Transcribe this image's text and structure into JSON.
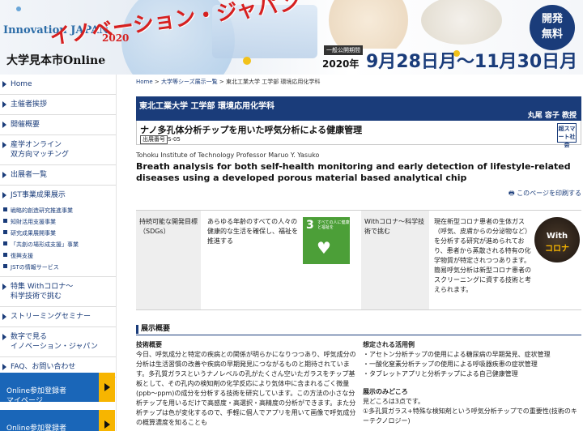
{
  "banner": {
    "logo_sub": "Innovation",
    "logo_main": "イノベーション・ジャパン",
    "logo_japan": "JAPAN",
    "logo_year": "2020",
    "logo_online": "大学見本市Online",
    "free_badge": [
      "開発",
      "無料"
    ],
    "period_label": "一般公開期間",
    "period_year": "2020年",
    "period_dates": "9月28日月〜11月30日月"
  },
  "sidebar": {
    "items": [
      {
        "label": "Home"
      },
      {
        "label": "主催者挨拶"
      },
      {
        "label": "開催概要"
      },
      {
        "label": "産学オンライン\n双方向マッチング"
      },
      {
        "label": "出展者一覧"
      }
    ],
    "jst_group": {
      "label": "JST事業成果展示",
      "subs": [
        "戦略的創造研究推進事業",
        "知財活用支援事業",
        "研究成果展開事業",
        "「共創の場形成支援」事業",
        "復興支援",
        "JSTの情報サービス"
      ]
    },
    "items2": [
      {
        "label": "特集 Withコロナ〜\n科学技術で挑む"
      },
      {
        "label": "ストリーミングセミナー"
      },
      {
        "label": "数字で見る\nイノベーション・ジャパン"
      },
      {
        "label": "FAQ、お問い合わせ"
      }
    ],
    "online_register": "Online参加登録者\nマイページ",
    "online_logout": "Online参加登録者\nログアウト"
  },
  "breadcrumb": {
    "home": "Home",
    "sep": " > ",
    "level1": "大学等シーズ展示一覧",
    "current": "東北工業大学 工学部 環境応用化学科"
  },
  "exhibit": {
    "university": "東北工業大学 工学部 環境応用化学科",
    "professor": "丸尾 容子 教授",
    "title": "ナノ多孔体分析チップを用いた呼気分析による健康管理",
    "label": "出展番号",
    "number": "S-05",
    "tag": "超スマート社会",
    "en_affiliation": "Tohoku Institute of Technology Professor Maruo Y. Yasuko",
    "en_title": "Breath analysis for both self-health monitoring and early detection of lifestyle-related diseases using a developed porous material based analytical chip",
    "print": "このページを印刷する"
  },
  "info": {
    "sdgs_head": "持続可能な開発目標（SDGs）",
    "sdgs_body": "あらゆる年齢のすべての人々の健康的な生活を確保し、福祉を推進する",
    "sdg_num": "3",
    "sdg_text": "すべての人に健康と福祉を",
    "corona_head": "Withコロナ〜科学技術で挑む",
    "corona_body": "現在新型コロナ患者の生体ガス（呼気、皮膚からの分泌物など）を分析する研究が進められており、患者から蒸散される特有の化学物質が特定されつつあります。簡易呼気分析は新型コロナ患者のスクリーニングに資する技術と考えられます。",
    "corona_w1": "With",
    "corona_w2": "コロナ"
  },
  "overview": {
    "heading": "展示概要",
    "tech_head": "技術概要",
    "tech_body": "今日、呼気成分と特定の疾病との関係が明らかになりつつあり、呼気成分の分析は生活習慣の改善や疾病の早期発見につながるものと期待されています。多孔質ガラスというナノレベルの孔がたくさん空いたガラスをチップ基板として、その孔内の検知剤の化学反応により気体中に含まれるごく微量(ppb〜ppm)の成分を分析する技術を研究しています。この方法の小さな分析チップを用いるだけで高感度・高選択・高精度の分析ができます。また分析チップは色が変化するので、手軽に個人でアプリを用いて画像で呼気成分の概算濃度を知ることも",
    "use_head": "想定される活用例",
    "use_items": [
      "・アセトン分析チップの使用による糖尿病の早期発見、症状管理",
      "・一酸化窒素分析チップの使用による呼吸器疾患の症状管理",
      "・タブレットアプリと分析チップによる自己健康管理"
    ],
    "point_head": "展示のみどころ",
    "point_body": "見どころは3点です。",
    "point_1": "①多孔質ガラス+特殊な検知剤という呼気分析チップでの重要性(技術のキーテクノロジー)"
  }
}
